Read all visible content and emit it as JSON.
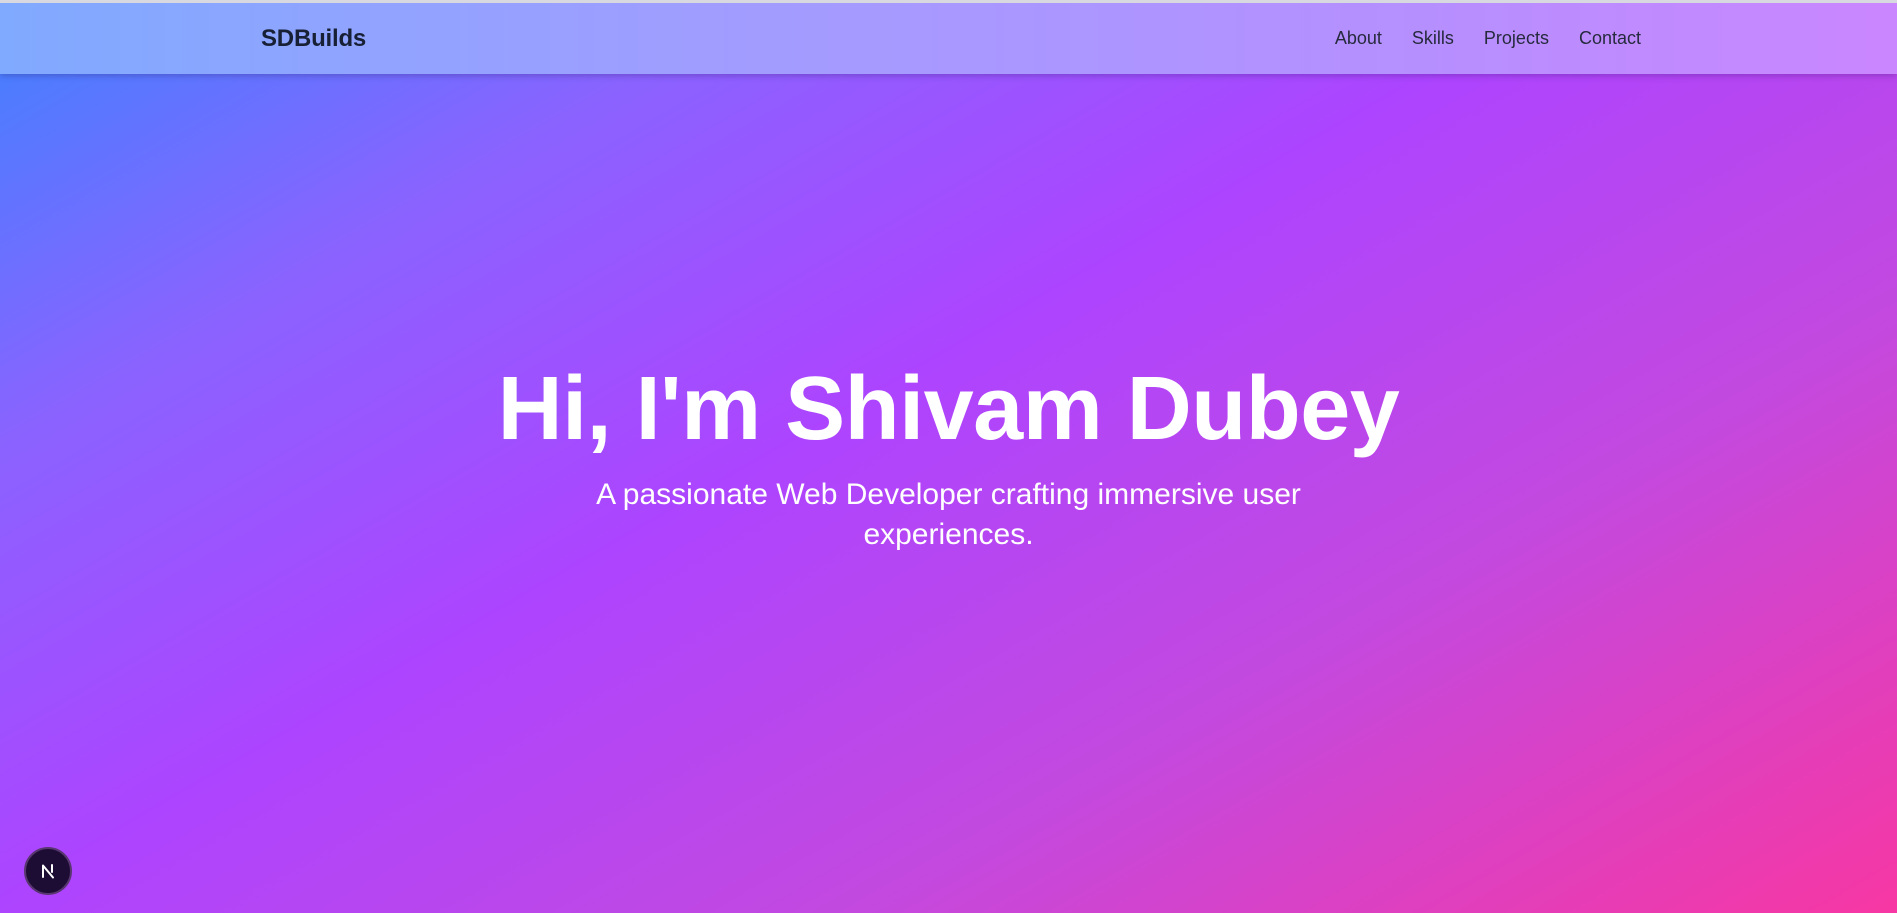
{
  "nav": {
    "brand": "SDBuilds",
    "links": [
      "About",
      "Skills",
      "Projects",
      "Contact"
    ]
  },
  "hero": {
    "title": "Hi, I'm Shivam Dubey",
    "subtitle": "A passionate Web Developer crafting immersive user experiences."
  },
  "dev_indicator": {
    "icon": "nextjs-logo-icon"
  },
  "colors": {
    "gradient_start": "#3f82ff",
    "gradient_mid": "#ad44ff",
    "gradient_end": "#f737a3",
    "header_start": "#80aaff",
    "header_end": "#ca86ff",
    "text_dark": "#182035",
    "text_light": "#ffffff"
  }
}
